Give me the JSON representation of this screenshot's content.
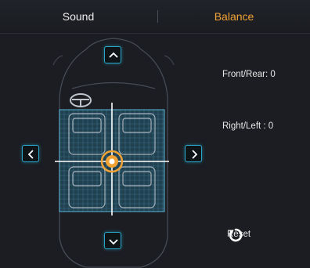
{
  "tabs": [
    {
      "label": "Sound",
      "active": false
    },
    {
      "label": "Balance",
      "active": true
    }
  ],
  "readouts": {
    "front_rear": "Front/Rear: 0",
    "right_left": "Right/Left : 0"
  },
  "reset": {
    "label": "Reset"
  },
  "balance": {
    "front_rear": 0,
    "right_left": 0
  },
  "colors": {
    "accent": "#f0a234",
    "grid": "#5bb7d9",
    "button_border": "#2aa7c8",
    "background": "#1b1d22"
  },
  "icons": {
    "up": "chevron-up-icon",
    "down": "chevron-down-icon",
    "left": "chevron-left-icon",
    "right": "chevron-right-icon",
    "reset": "rotate-icon"
  }
}
